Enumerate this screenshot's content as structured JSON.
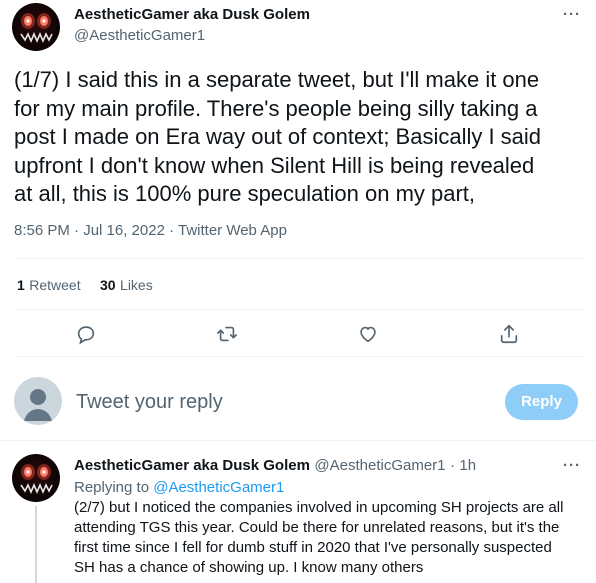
{
  "tweet": {
    "author_name": "AestheticGamer aka Dusk Golem",
    "author_handle": "@AestheticGamer1",
    "more_label": "···",
    "text_lines": [
      "(1/7) I said this in a separate tweet, but I'll make it one",
      "for my main profile. There's people being silly taking a",
      "post I made on Era way out of context; Basically I said",
      "upfront I don't know when Silent Hill is being revealed",
      "at all, this is 100% pure speculation on my part,"
    ],
    "timestamp": "8:56 PM · Jul 16, 2022 · ",
    "source": "Twitter Web App"
  },
  "stats": {
    "retweets_count": "1",
    "retweets_label": "Retweet",
    "likes_count": "30",
    "likes_label": "Likes"
  },
  "actions": [
    "reply-icon",
    "retweet-icon",
    "like-icon",
    "share-icon"
  ],
  "composer": {
    "placeholder": "Tweet your reply",
    "button_label": "Reply"
  },
  "reply": {
    "author_name": "AestheticGamer aka Dusk Golem",
    "author_handle": "@AestheticGamer1",
    "separator": "·",
    "time_ago": "1h",
    "more_label": "···",
    "replying_to_prefix": "Replying to ",
    "replying_to_handle": "@AestheticGamer1",
    "text_lines": [
      "(2/7) but I noticed the companies involved in upcoming SH projects are all",
      "attending TGS this year. Could be there for unrelated reasons, but it's the",
      "first time since I fell for dumb stuff in 2020 that I've personally suspected",
      "SH has a chance of showing up. I know many others"
    ]
  },
  "colors": {
    "link": "#1d9bf0",
    "reply_button": "#8ecdf8",
    "secondary_text": "#536471"
  }
}
